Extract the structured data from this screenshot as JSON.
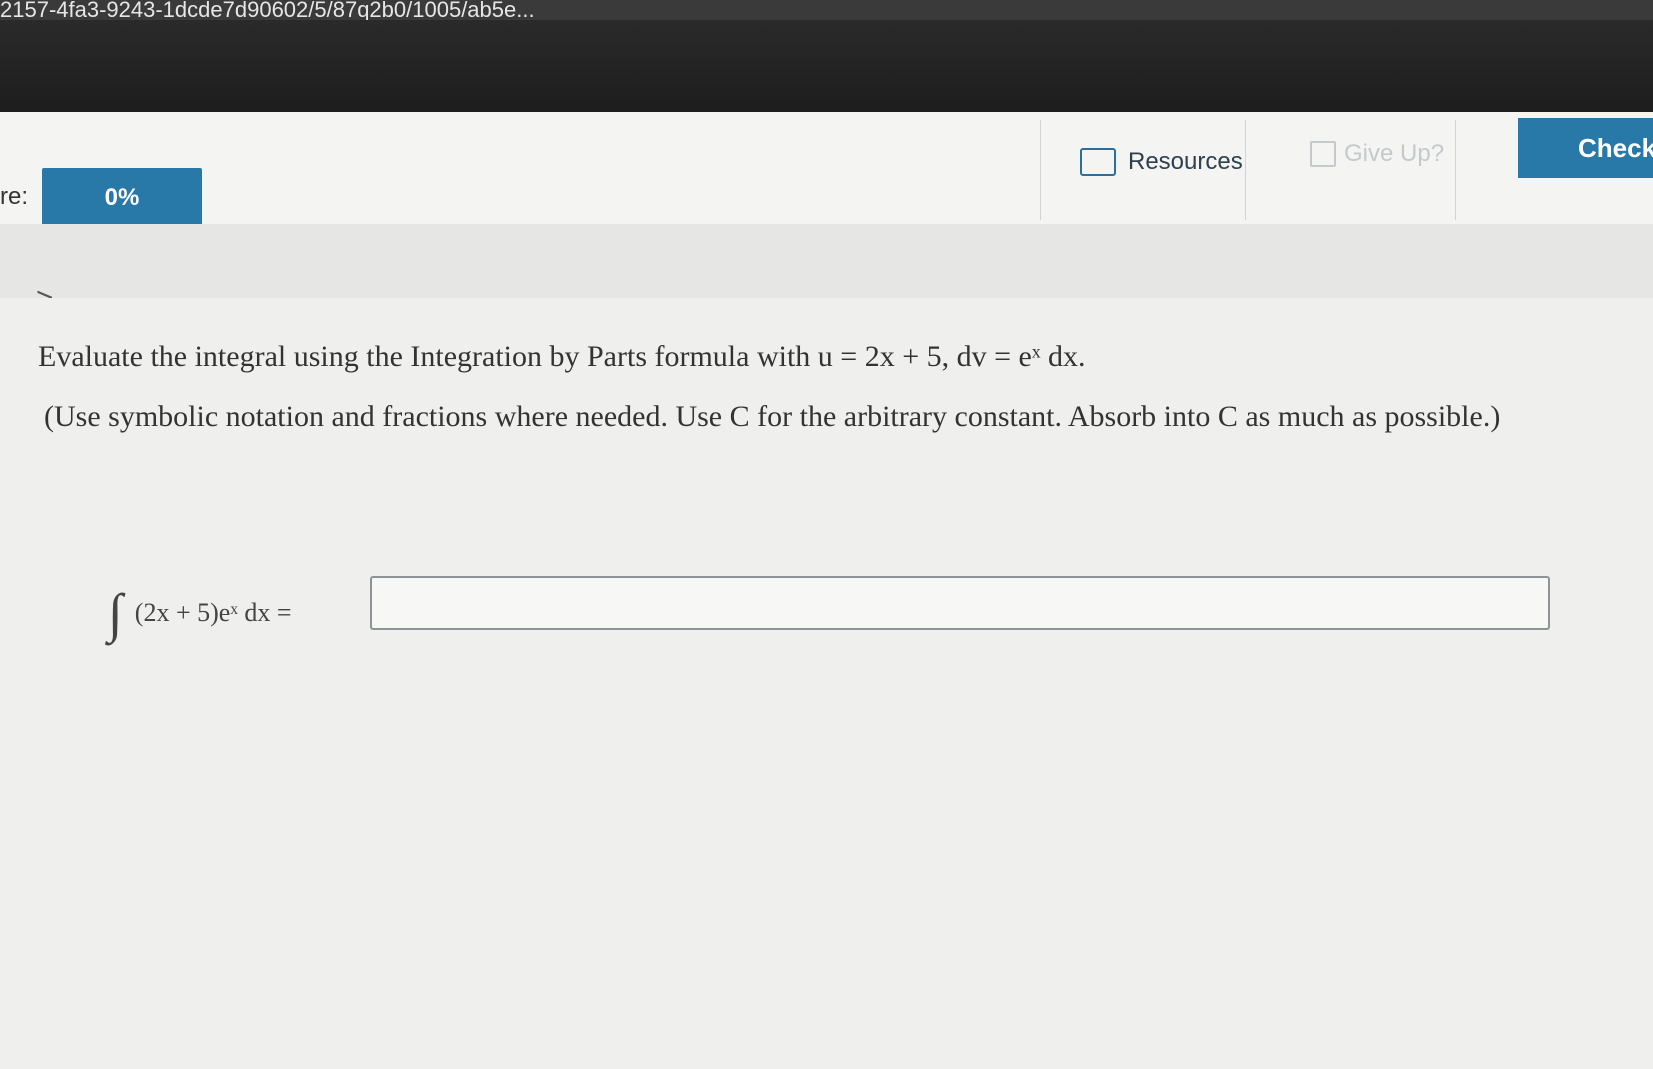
{
  "url": {
    "text": "2157-4fa3-9243-1dcde7d90602/5/87q2b0/1005/ab5e..."
  },
  "toolbar": {
    "score_label": "re:",
    "score_value": "0%",
    "resources_label": "Resources",
    "give_up_label": "Give Up?",
    "check_label": "Check"
  },
  "nav": {
    "chevron": ">"
  },
  "question": {
    "line1": "Evaluate the integral using the Integration by Parts formula with u = 2x + 5, dv = eˣ dx.",
    "line2": "(Use symbolic notation and fractions where needed. Use C for the arbitrary constant. Absorb into C as much as possible.)",
    "integral_sign": "∫",
    "integrand": "(2x + 5)eˣ dx =",
    "answer_value": "",
    "answer_placeholder": ""
  },
  "colors": {
    "accent": "#2878a8",
    "disabled": "#c5c9cc"
  }
}
